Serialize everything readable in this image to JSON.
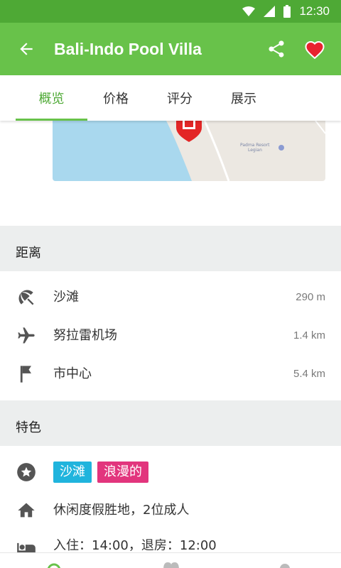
{
  "status_bar": {
    "time": "12:30"
  },
  "app_bar": {
    "title": "Bali-Indo Pool Villa",
    "back_icon": "arrow-back-icon",
    "share_icon": "share-icon",
    "favorite_icon": "heart-icon"
  },
  "tabs": [
    {
      "label": "概览",
      "active": true
    },
    {
      "label": "价格",
      "active": false
    },
    {
      "label": "评分",
      "active": false
    },
    {
      "label": "展示",
      "active": false
    }
  ],
  "map": {
    "poi_label_line1": "Padma Resort",
    "poi_label_line2": "Legian"
  },
  "distance": {
    "title": "距离",
    "items": [
      {
        "icon": "beach-umbrella-icon",
        "label": "沙滩",
        "value": "290 m"
      },
      {
        "icon": "airplane-icon",
        "label": "努拉雷机场",
        "value": "1.4 km"
      },
      {
        "icon": "flag-icon",
        "label": "市中心",
        "value": "5.4 km"
      }
    ]
  },
  "features": {
    "title": "特色",
    "tags": [
      {
        "label": "沙滩",
        "color": "#20b4dd"
      },
      {
        "label": "浪漫的",
        "color": "#e2357d"
      }
    ],
    "type": "休闲度假胜地，2位成人",
    "checkin": "入住：14:00，退房：12:00"
  },
  "colors": {
    "primary": "#68c24a",
    "primary_dark": "#4ea935"
  }
}
